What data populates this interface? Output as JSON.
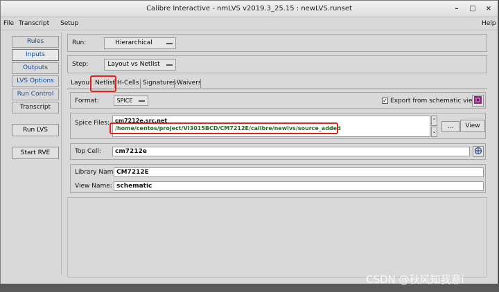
{
  "window": {
    "title": "Calibre Interactive - nmLVS v2019.3_25.15 : newLVS.runset",
    "controls": {
      "minimize": "–",
      "maximize": "□",
      "close": "×"
    }
  },
  "menubar": {
    "file": "File",
    "transcript": "Transcript",
    "setup": "Setup",
    "help": "Help"
  },
  "sidebar": {
    "items": [
      {
        "label": "Rules"
      },
      {
        "label": "Inputs"
      },
      {
        "label": "Outputs"
      },
      {
        "label": "LVS Options"
      },
      {
        "label": "Run Control"
      },
      {
        "label": "Transcript"
      }
    ],
    "active_item": "Inputs",
    "run_lvs": "Run LVS",
    "start_rve": "Start RVE"
  },
  "inputs": {
    "run_label": "Run:",
    "run_value": "Hierarchical",
    "step_label": "Step:",
    "step_value": "Layout vs Netlist",
    "tabs": [
      "Layout",
      "Netlist",
      "H-Cells",
      "Signatures",
      "Waivers"
    ],
    "active_tab": "Netlist",
    "format_label": "Format:",
    "format_value": "SPICE",
    "export_label": "Export from schematic viewer",
    "export_checked": true,
    "spice_files_label": "Spice Files:",
    "spice_files": [
      "cm7212e.src.net",
      "/home/centos/project/VI3015BCD/CM7212E/calibre/newlvs/source_added"
    ],
    "browse_label": "...",
    "view_label": "View",
    "top_cell_label": "Top Cell:",
    "top_cell_value": "cm7212e",
    "library_name_label": "Library Name:",
    "library_name_value": "CM7212E",
    "view_name_label": "View Name:",
    "view_name_value": "schematic"
  },
  "watermark": "CSDN @秋风知我意i",
  "colors": {
    "highlight": "#e3211c",
    "link": "#0b4f9c",
    "path_text": "#1f6b1f"
  },
  "icons": [
    "schematic-viewer-icon",
    "cell-browse-icon",
    "scroll-up-icon",
    "scroll-down-icon"
  ]
}
